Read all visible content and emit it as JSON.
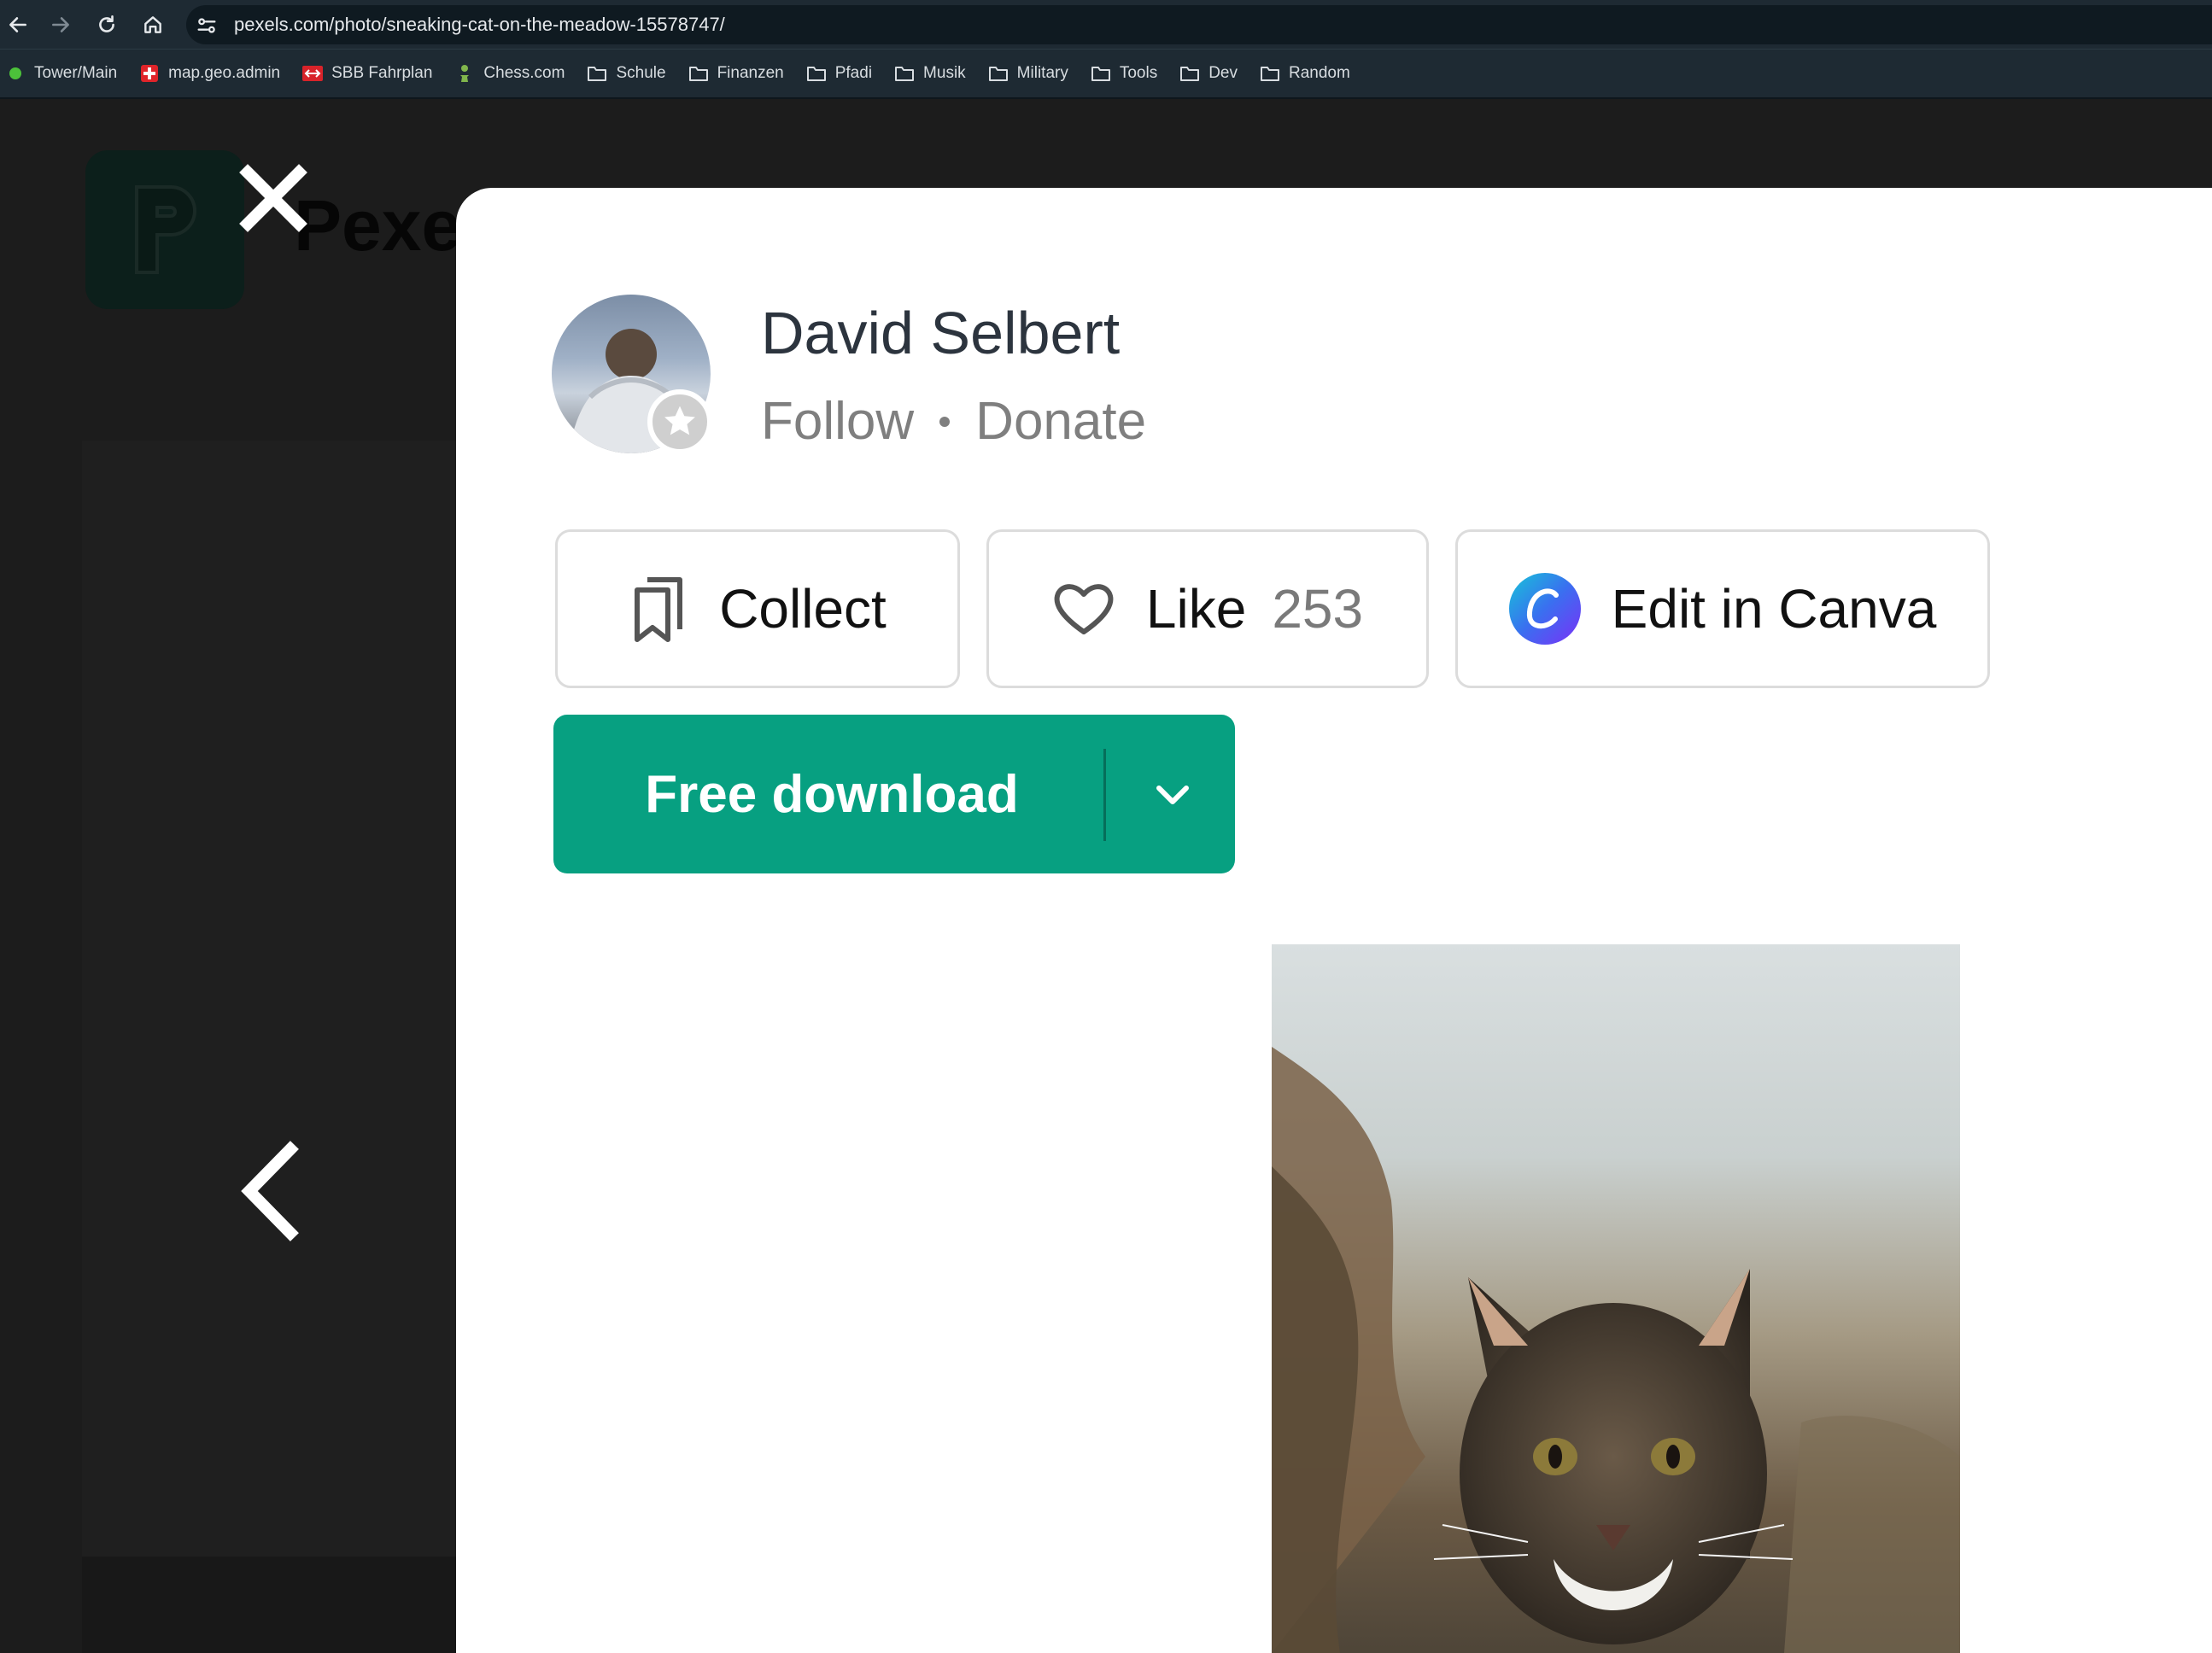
{
  "browser": {
    "url": "pexels.com/photo/sneaking-cat-on-the-meadow-15578747/",
    "bookmarks": [
      {
        "label": "Tower/Main",
        "icon": "green-dot-icon"
      },
      {
        "label": "map.geo.admin",
        "icon": "swiss-cross-icon"
      },
      {
        "label": "SBB Fahrplan",
        "icon": "sbb-icon"
      },
      {
        "label": "Chess.com",
        "icon": "chess-pawn-icon"
      },
      {
        "label": "Schule",
        "icon": "folder-icon"
      },
      {
        "label": "Finanzen",
        "icon": "folder-icon"
      },
      {
        "label": "Pfadi",
        "icon": "folder-icon"
      },
      {
        "label": "Musik",
        "icon": "folder-icon"
      },
      {
        "label": "Military",
        "icon": "folder-icon"
      },
      {
        "label": "Tools",
        "icon": "folder-icon"
      },
      {
        "label": "Dev",
        "icon": "folder-icon"
      },
      {
        "label": "Random",
        "icon": "folder-icon"
      }
    ]
  },
  "background": {
    "logo_text": "Pexe"
  },
  "modal": {
    "author_name": "David Selbert",
    "follow_label": "Follow",
    "donate_label": "Donate",
    "collect_label": "Collect",
    "like_label": "Like",
    "like_count": "253",
    "canva_label": "Edit in Canva",
    "download_label": "Free download"
  },
  "colors": {
    "download_green": "#07a081",
    "modal_bg": "#ffffff",
    "overlay_bg": "#1c1c1c"
  }
}
